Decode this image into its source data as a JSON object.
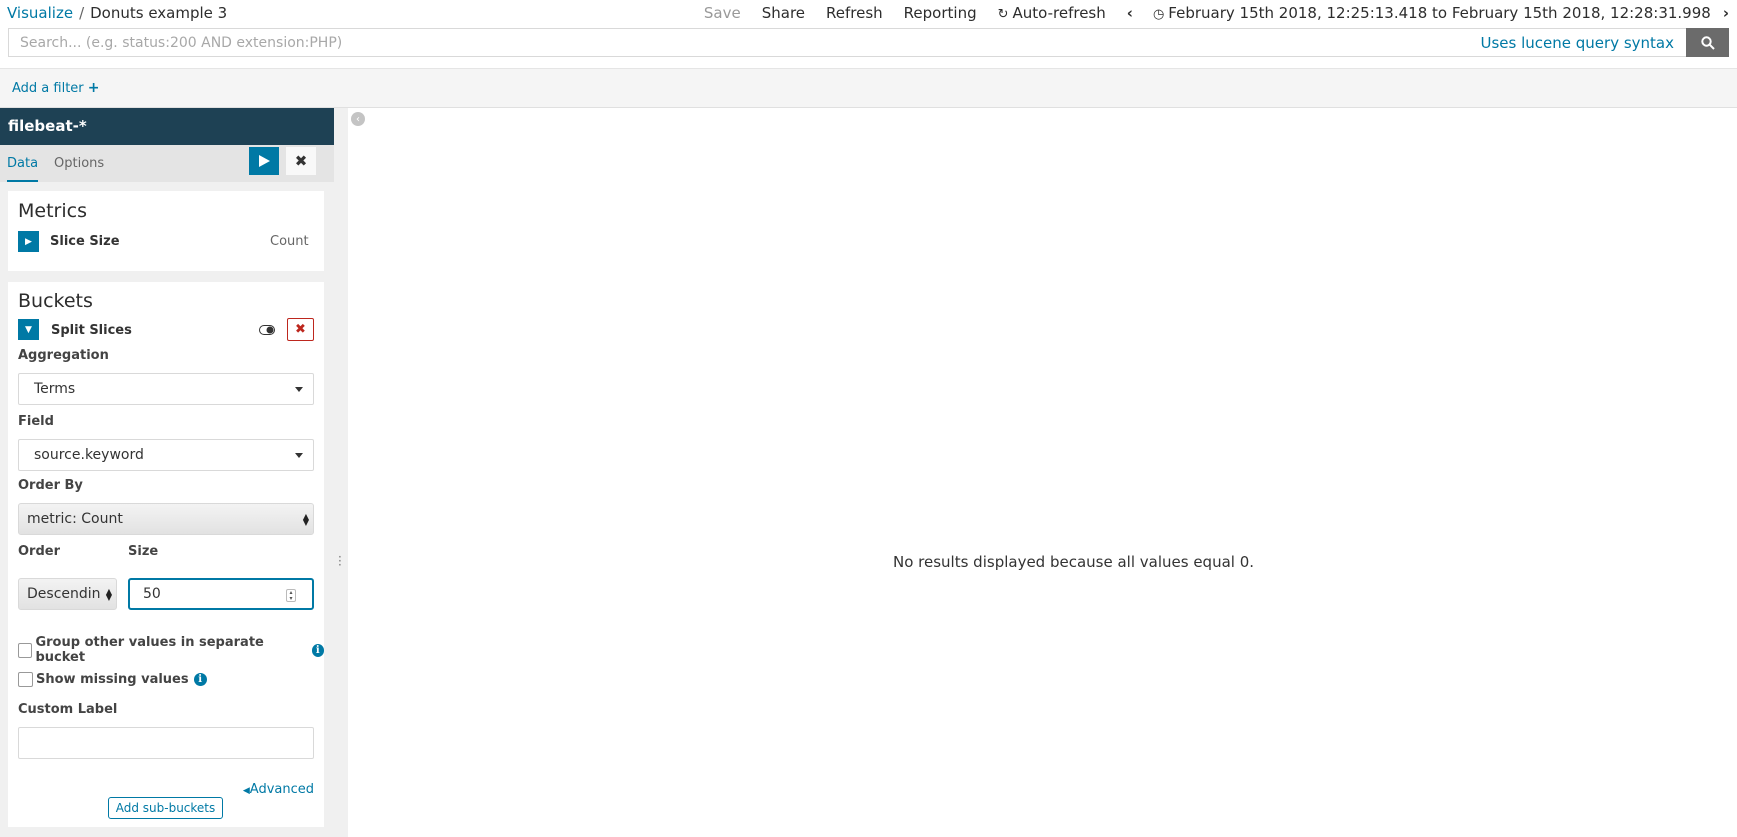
{
  "breadcrumb": {
    "root": "Visualize",
    "separator": "/",
    "current": "Donuts example 3"
  },
  "top_menu": {
    "save": "Save",
    "share": "Share",
    "refresh": "Refresh",
    "reporting": "Reporting",
    "auto_refresh": "Auto-refresh",
    "time_range": "February 15th 2018, 12:25:13.418 to February 15th 2018, 12:28:31.998"
  },
  "search": {
    "placeholder": "Search... (e.g. status:200 AND extension:PHP)",
    "syntax_link": "Uses lucene query syntax"
  },
  "filter_bar": {
    "add_filter": "Add a filter",
    "plus": "+"
  },
  "sidebar": {
    "index_pattern": "filebeat-*",
    "tabs": [
      {
        "label": "Data"
      },
      {
        "label": "Options"
      }
    ],
    "metrics": {
      "title": "Metrics",
      "agg_label": "Slice Size",
      "agg_value": "Count"
    },
    "buckets": {
      "title": "Buckets",
      "agg_label": "Split Slices",
      "aggregation_label": "Aggregation",
      "aggregation_value": "Terms",
      "field_label": "Field",
      "field_value": "source.keyword",
      "order_by_label": "Order By",
      "order_by_value": "metric: Count",
      "order_label": "Order",
      "order_value": "Descendin",
      "size_label": "Size",
      "size_value": "50",
      "group_other_label": "Group other values in separate bucket",
      "show_missing_label": "Show missing values",
      "custom_label_label": "Custom Label",
      "custom_label_value": "",
      "advanced_link": "Advanced",
      "add_sub_buckets": "Add sub-buckets"
    }
  },
  "main": {
    "message": "No results displayed because all values equal 0."
  },
  "colors": {
    "accent": "#0079a5",
    "header": "#1e4154",
    "danger": "#bd271e"
  }
}
